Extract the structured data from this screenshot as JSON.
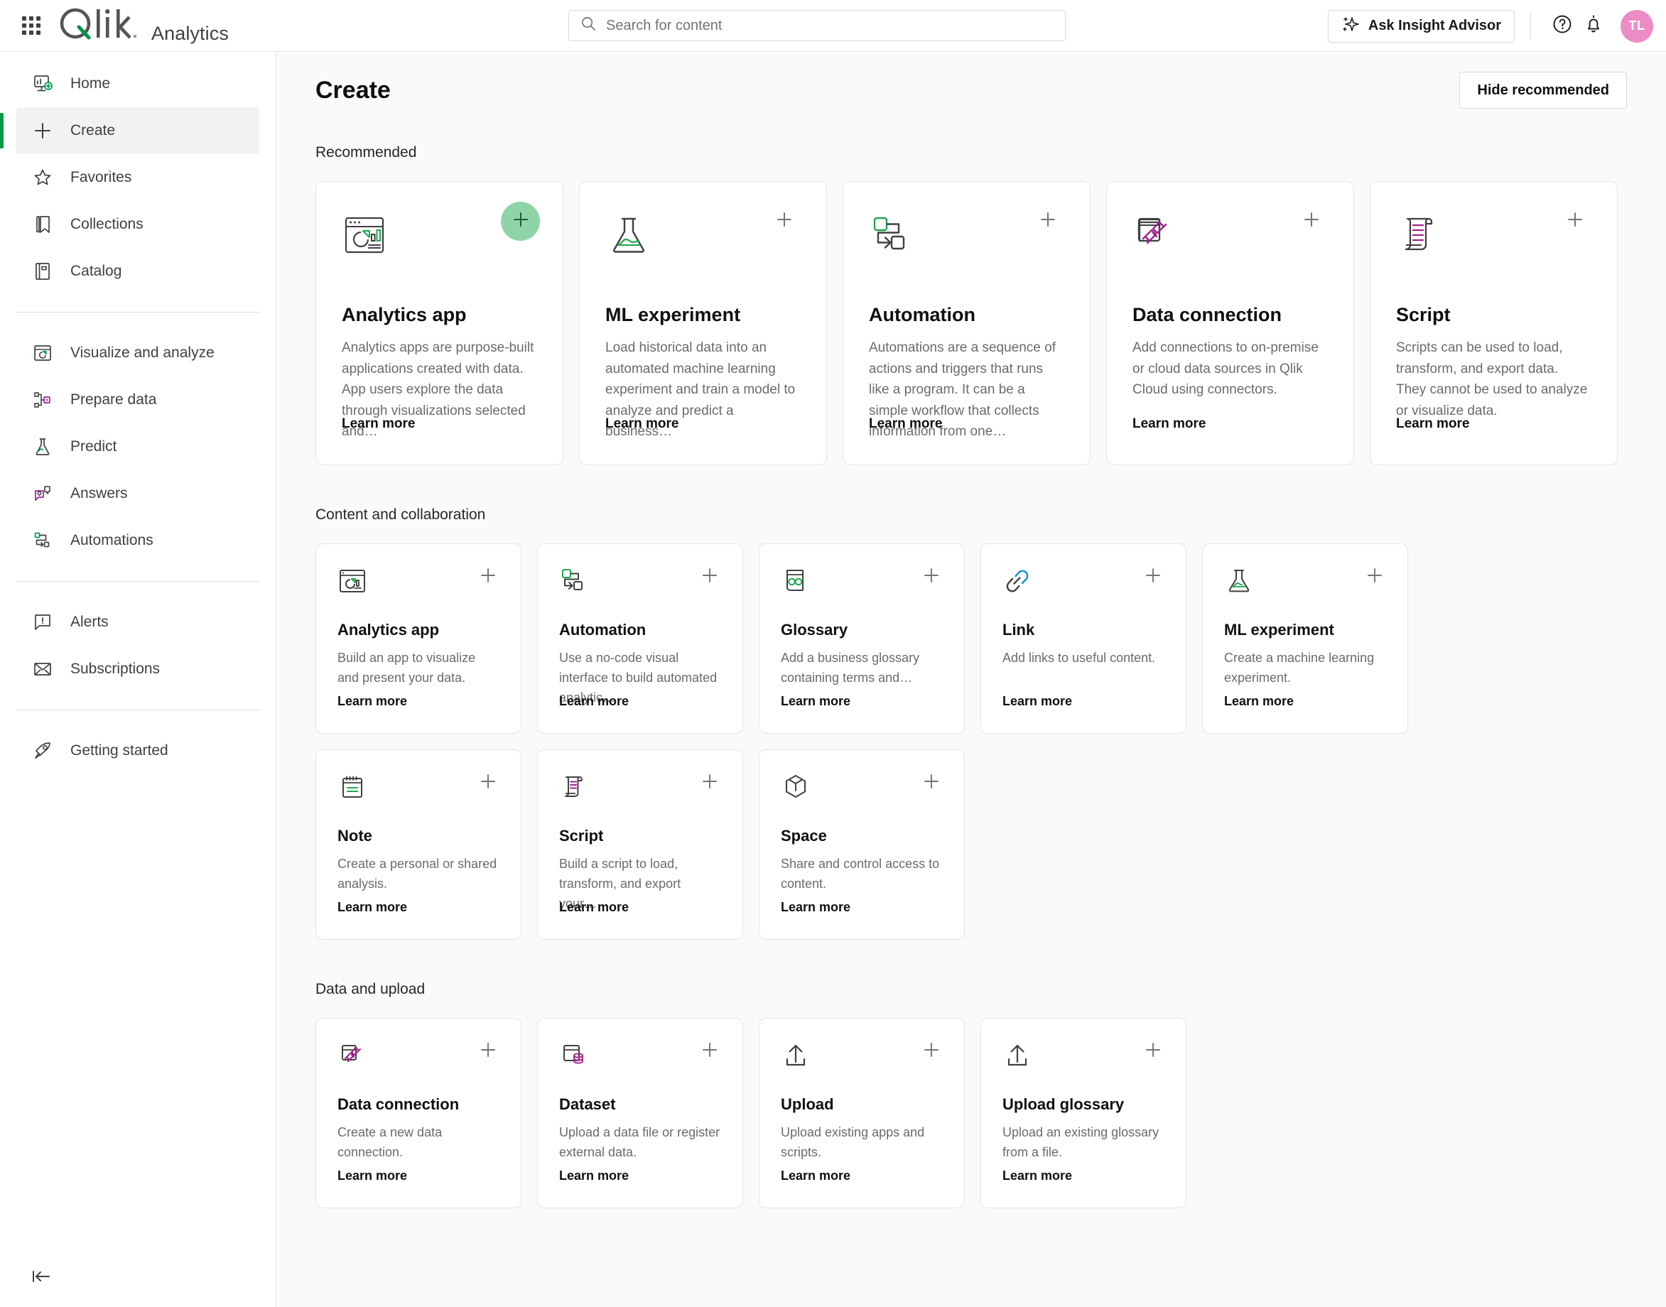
{
  "header": {
    "product": "Analytics",
    "logo_text": "Qlik",
    "search": {
      "placeholder": "Search for content",
      "value": ""
    },
    "insight_advisor_label": "Ask Insight Advisor",
    "avatar_initials": "TL",
    "accent_green": "#009845",
    "avatar_color": "#ec8cc4"
  },
  "sidebar": {
    "groups": [
      {
        "items": [
          {
            "label": "Home",
            "icon": "home-dashboard-icon",
            "active": false
          },
          {
            "label": "Create",
            "icon": "plus-icon",
            "active": true
          },
          {
            "label": "Favorites",
            "icon": "star-icon",
            "active": false
          },
          {
            "label": "Collections",
            "icon": "bookmark-icon",
            "active": false
          },
          {
            "label": "Catalog",
            "icon": "book-icon",
            "active": false
          }
        ]
      },
      {
        "items": [
          {
            "label": "Visualize and analyze",
            "icon": "chart-window-icon",
            "active": false
          },
          {
            "label": "Prepare data",
            "icon": "data-nodes-icon",
            "active": false
          },
          {
            "label": "Predict",
            "icon": "flask-icon",
            "active": false
          },
          {
            "label": "Answers",
            "icon": "speech-bubbles-icon",
            "active": false
          },
          {
            "label": "Automations",
            "icon": "automation-flow-icon",
            "active": false
          }
        ]
      },
      {
        "items": [
          {
            "label": "Alerts",
            "icon": "alert-bubble-icon",
            "active": false
          },
          {
            "label": "Subscriptions",
            "icon": "envelope-icon",
            "active": false
          }
        ]
      },
      {
        "items": [
          {
            "label": "Getting started",
            "icon": "rocket-icon",
            "active": false
          }
        ]
      }
    ],
    "collapse_icon": "collapse-left-icon"
  },
  "main": {
    "page_title": "Create",
    "hide_recommended_label": "Hide recommended",
    "learn_more_label": "Learn more",
    "sections": [
      {
        "id": "recommended",
        "title": "Recommended",
        "cards": [
          {
            "title": "Analytics app",
            "desc": "Analytics apps are purpose-built applications created with data. App users explore the data through visualizations selected and…",
            "icon": "analytics-app-icon",
            "add_highlighted": true
          },
          {
            "title": "ML experiment",
            "desc": "Load historical data into an automated machine learning experiment and train a model to analyze and predict a business…",
            "icon": "flask-icon",
            "add_highlighted": false
          },
          {
            "title": "Automation",
            "desc": "Automations are a sequence of actions and triggers that runs like a program. It can be a simple workflow that collects information from one…",
            "icon": "automation-flow-icon",
            "add_highlighted": false
          },
          {
            "title": "Data connection",
            "desc": "Add connections to on-premise or cloud data sources in Qlik Cloud using connectors.",
            "icon": "data-connection-icon",
            "add_highlighted": false
          },
          {
            "title": "Script",
            "desc": "Scripts can be used to load, transform, and export data. They cannot be used to analyze or visualize data.",
            "icon": "script-scroll-icon",
            "add_highlighted": false
          }
        ]
      },
      {
        "id": "content-and-collaboration",
        "title": "Content and collaboration",
        "cards": [
          {
            "title": "Analytics app",
            "desc": "Build an app to visualize and present your data.",
            "icon": "analytics-app-small-icon"
          },
          {
            "title": "Automation",
            "desc": "Use a no-code visual interface to build automated analytic…",
            "icon": "automation-flow-icon"
          },
          {
            "title": "Glossary",
            "desc": "Add a business glossary containing terms and…",
            "icon": "glossary-icon"
          },
          {
            "title": "Link",
            "desc": "Add links to useful content.",
            "icon": "link-icon"
          },
          {
            "title": "ML experiment",
            "desc": "Create a machine learning experiment.",
            "icon": "flask-icon"
          },
          {
            "title": "Note",
            "desc": "Create a personal or shared analysis.",
            "icon": "note-icon"
          },
          {
            "title": "Script",
            "desc": "Build a script to load, transform, and export your…",
            "icon": "script-scroll-icon"
          },
          {
            "title": "Space",
            "desc": "Share and control access to content.",
            "icon": "space-cube-icon"
          }
        ]
      },
      {
        "id": "data-and-upload",
        "title": "Data and upload",
        "cards": [
          {
            "title": "Data connection",
            "desc": "Create a new data connection.",
            "icon": "data-connection-icon"
          },
          {
            "title": "Dataset",
            "desc": "Upload a data file or register external data.",
            "icon": "dataset-icon"
          },
          {
            "title": "Upload",
            "desc": "Upload existing apps and scripts.",
            "icon": "upload-icon"
          },
          {
            "title": "Upload glossary",
            "desc": "Upload an existing glossary from a file.",
            "icon": "upload-icon"
          }
        ]
      }
    ]
  }
}
